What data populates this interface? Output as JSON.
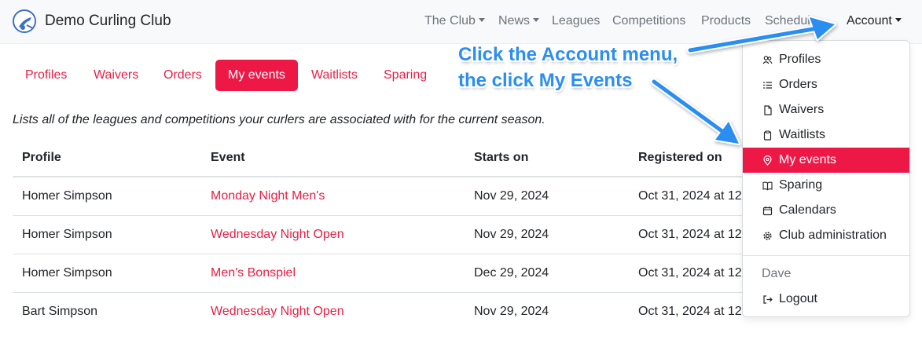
{
  "navbar": {
    "brand": "Demo Curling Club",
    "items": [
      {
        "label": "The Club",
        "dropdown": true
      },
      {
        "label": "News",
        "dropdown": true
      },
      {
        "label": "Leagues",
        "dropdown": false
      },
      {
        "label": "Competitions",
        "dropdown": false
      },
      {
        "label": "Products",
        "dropdown": false
      },
      {
        "label": "Schedule",
        "dropdown": false
      }
    ],
    "account": "Account"
  },
  "tabs": [
    {
      "label": "Profiles",
      "active": false
    },
    {
      "label": "Waivers",
      "active": false
    },
    {
      "label": "Orders",
      "active": false
    },
    {
      "label": "My events",
      "active": true
    },
    {
      "label": "Waitlists",
      "active": false
    },
    {
      "label": "Sparing",
      "active": false
    }
  ],
  "description": "Lists all of the leagues and competitions your curlers are associated with for the current season.",
  "table": {
    "headers": [
      "Profile",
      "Event",
      "Starts on",
      "Registered on"
    ],
    "rows": [
      [
        "Homer Simpson",
        "Monday Night Men's",
        "Nov 29, 2024",
        "Oct 31, 2024 at 12"
      ],
      [
        "Homer Simpson",
        "Wednesday Night Open",
        "Nov 29, 2024",
        "Oct 31, 2024 at 12"
      ],
      [
        "Homer Simpson",
        "Men's Bonspiel",
        "Dec 29, 2024",
        "Oct 31, 2024 at 12"
      ],
      [
        "Bart Simpson",
        "Wednesday Night Open",
        "Nov 29, 2024",
        "Oct 31, 2024 at 12"
      ]
    ]
  },
  "account_menu": {
    "items": [
      {
        "label": "Profiles",
        "icon": "people-icon"
      },
      {
        "label": "Orders",
        "icon": "list-icon"
      },
      {
        "label": "Waivers",
        "icon": "file-icon"
      },
      {
        "label": "Waitlists",
        "icon": "clipboard-icon"
      },
      {
        "label": "My events",
        "icon": "pin-icon",
        "active": true
      },
      {
        "label": "Sparing",
        "icon": "book-icon"
      },
      {
        "label": "Calendars",
        "icon": "calendar-icon"
      },
      {
        "label": "Club administration",
        "icon": "gear-icon"
      }
    ],
    "user_header": "Dave",
    "logout": {
      "label": "Logout",
      "icon": "logout-icon"
    }
  },
  "annotation": {
    "line1": "Click the Account menu,",
    "line2": "the click My Events"
  },
  "colors": {
    "accent": "#ee1847",
    "link": "#e91e45",
    "annotation": "#2b8ef0"
  }
}
